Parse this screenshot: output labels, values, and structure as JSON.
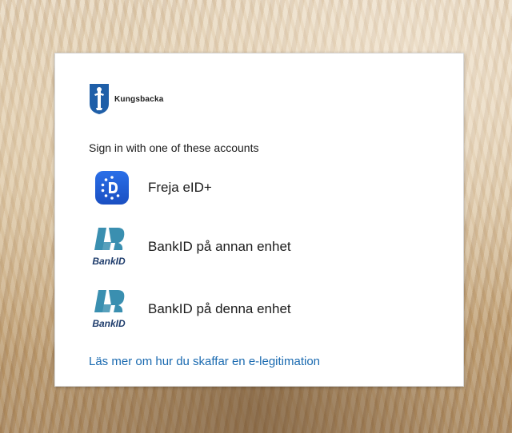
{
  "organization": {
    "name": "Kungsbacka",
    "logo_icon": "coat-of-arms-icon"
  },
  "heading": "Sign in with one of these accounts",
  "options": [
    {
      "label": "Freja eID+",
      "icon": "freja-eid-icon"
    },
    {
      "label": "BankID på annan enhet",
      "icon": "bankid-icon",
      "logo_text": "BankID"
    },
    {
      "label": "BankID på denna enhet",
      "icon": "bankid-icon",
      "logo_text": "BankID"
    }
  ],
  "link_text": "Läs mer om hur du skaffar en e-legitimation",
  "colors": {
    "freja_blue": "#1f5fd6",
    "bankid_teal": "#3a8fb0",
    "bankid_navy": "#1d3b6b",
    "link": "#1a6ab0"
  }
}
